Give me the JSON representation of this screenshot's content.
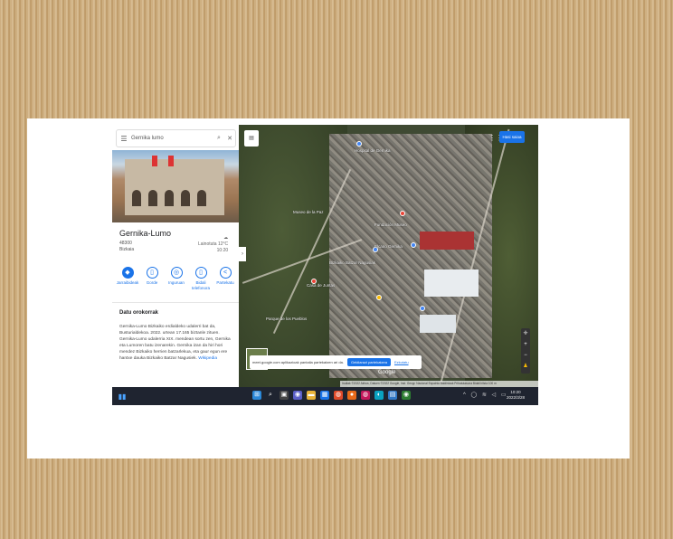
{
  "search": {
    "value": "Gernika lumo",
    "menu_icon": "hamburger-icon",
    "search_icon": "search-icon",
    "close_icon": "close-icon"
  },
  "place": {
    "name": "Gernika-Lumo",
    "postal": "48300",
    "province": "Bizkaia",
    "weather_label": "Lainotuta",
    "temperature": "12°C",
    "time": "10:20"
  },
  "actions": [
    {
      "label": "Jarraibideak",
      "icon": "directions-icon"
    },
    {
      "label": "Gorde",
      "icon": "bookmark-icon"
    },
    {
      "label": "Inguruan",
      "icon": "nearby-icon"
    },
    {
      "label": "Bidali telefonora",
      "icon": "phone-icon"
    },
    {
      "label": "Partekatu",
      "icon": "share-icon"
    }
  ],
  "info": {
    "heading": "Datu orokorrak",
    "body": "Gernika-Lumo Bizkaiko erdialdeko udalerri bat da, Busturialdekoa. 2022. urtean 17.165 biztanle zituen. Gernika-Lumo udalerria XIX. mendean sortu zen, Gernika eta Lumoren batu izenarekin. Gernika izan da hiri hori mendez Bizkaiko herrien batzarlekua, eta gaur egun ere hantxe dauka Bizkaiko Batzar Nagusiek.",
    "link": "Wikipedia"
  },
  "map": {
    "signin_label": "Hasi saioa",
    "labels": [
      "Hospital de Gernika",
      "Museo de la Paz",
      "Fundación Museo",
      "Bizkaiko Batzar Nagusiak",
      "Casa de Juntas",
      "Elcano Gernika",
      "Parque de los Pueblos"
    ],
    "share_notice": "meet.google.com aplikazioak pantaila partekatzen ari da.",
    "share_stop": "Geldiarazi partekatzea",
    "share_hide": "Ezkutatu",
    "logo": "Google",
    "attribution": "Irudiak ©2022 Airbus, Datuen ©2022 Google, Inst. Geogr. Nacional   Espainia   Baldintzak   Pribatutasuna   Bidali iritzia   100 m",
    "zoom_in": "+",
    "zoom_out": "−"
  },
  "taskbar": {
    "time": "10:20",
    "date": "2022/3/28"
  },
  "colors": {
    "accent": "#1a73e8",
    "taskbar": "#1f2430"
  }
}
